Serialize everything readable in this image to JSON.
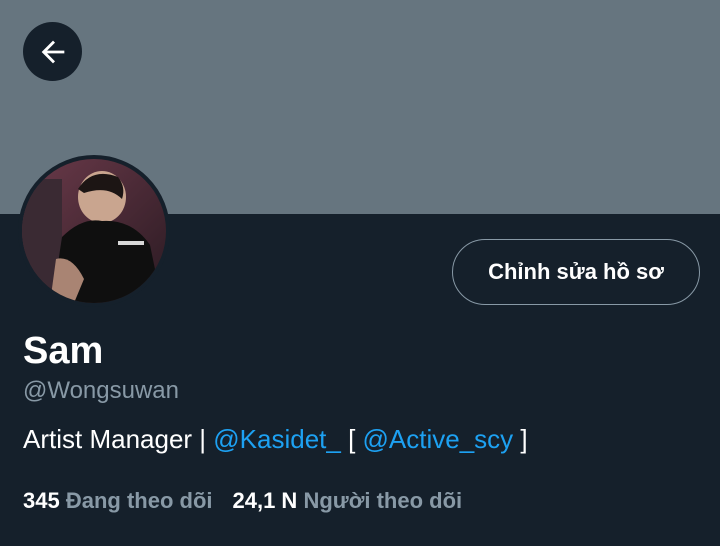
{
  "header": {
    "back_icon": "arrow-left-icon"
  },
  "profile": {
    "name": "Sam",
    "handle": "@Wongsuwan",
    "edit_label": "Chỉnh sửa hồ sơ",
    "bio": {
      "prefix": "Artist Manager | ",
      "mention1": "@Kasidet_",
      "middle": " [ ",
      "mention2": "@Active_scy",
      "suffix": " ]"
    }
  },
  "stats": {
    "following_count": "345",
    "following_label": "Đang theo dõi",
    "followers_count": "24,1 N",
    "followers_label": "Người theo dõi"
  },
  "colors": {
    "background": "#15202b",
    "banner": "#66757f",
    "accent": "#1da1f2",
    "muted_text": "#8899a6"
  }
}
